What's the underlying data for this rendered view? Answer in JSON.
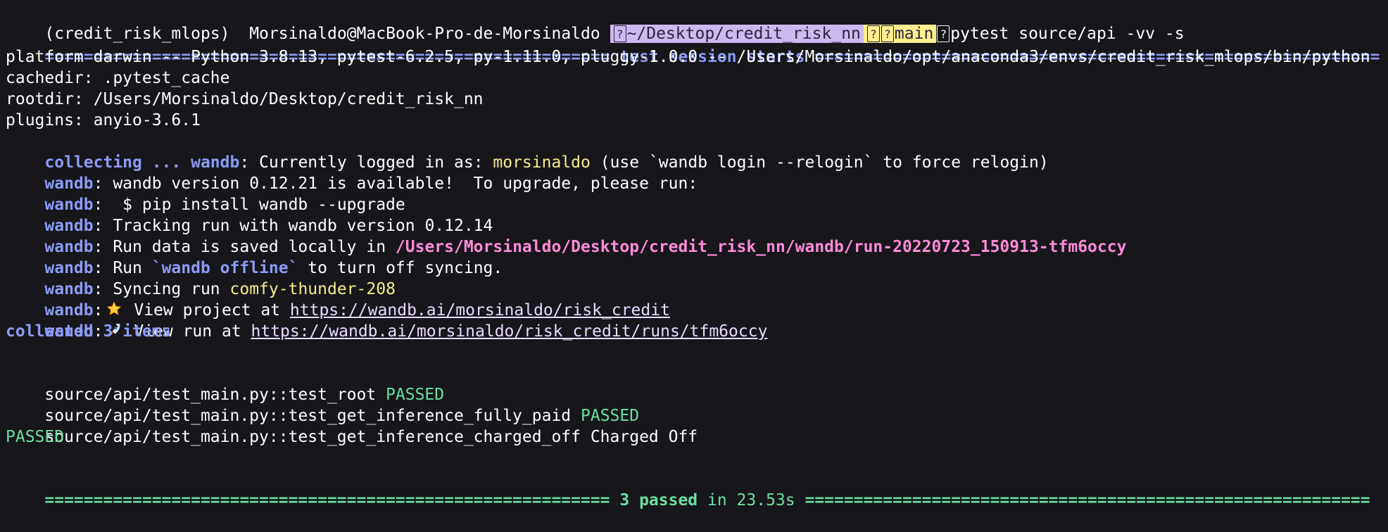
{
  "terminal": {
    "prompt": {
      "env": "(credit_risk_mlops)",
      "user_host": "Morsinaldo@MacBook-Pro-de-Morsinaldo",
      "icon_1": "?",
      "path": "~/Desktop/credit_risk_nn",
      "icon_2": "?",
      "icon_3": "?",
      "branch": "main",
      "icon_4": "?",
      "command": "pytest source/api -vv -s"
    },
    "session_header": {
      "left": "==========================================================",
      "title": " test session starts ",
      "right": "=========================================================="
    },
    "lines": [
      "platform darwin -- Python 3.8.13, pytest-6.2.5, py-1.11.0, pluggy-1.0.0 -- /Users/Morsinaldo/opt/anaconda3/envs/credit_risk_mlops/bin/python",
      "cachedir: .pytest_cache",
      "rootdir: /Users/Morsinaldo/Desktop/credit_risk_nn",
      "plugins: anyio-3.6.1"
    ],
    "collecting_prefix": "collecting ... ",
    "wandb_label": "wandb",
    "wandb": {
      "logged_in_prefix": ": Currently logged in as: ",
      "logged_in_user": "morsinaldo",
      "logged_in_suffix": " (use `wandb login --relogin` to force relogin)",
      "version_available": ": wandb version 0.12.21 is available!  To upgrade, please run:",
      "pip_install": ":  $ pip install wandb --upgrade",
      "tracking": ": Tracking run with wandb version 0.12.14",
      "run_data_prefix": ": Run data is saved locally in ",
      "run_data_path": "/Users/Morsinaldo/Desktop/credit_risk_nn/wandb/run-20220723_150913-tfm6occy",
      "run_offline_prefix": ": Run ",
      "run_offline_cmd": "`wandb offline`",
      "run_offline_suffix": " to turn off syncing.",
      "syncing_prefix": ": Syncing run ",
      "syncing_name": "comfy-thunder-208",
      "project_prefix": ":",
      "project_text": " View project at ",
      "project_url": "https://wandb.ai/morsinaldo/risk_credit",
      "run_prefix": ":",
      "run_text": " View run at ",
      "run_url": "https://wandb.ai/morsinaldo/risk_credit/runs/tfm6occy"
    },
    "collected": "collected 3 items",
    "tests": [
      {
        "name": "source/api/test_main.py::test_root ",
        "result": "PASSED"
      },
      {
        "name": "source/api/test_main.py::test_get_inference_fully_paid ",
        "result": "PASSED"
      },
      {
        "name": "source/api/test_main.py::test_get_inference_charged_off Charged Off",
        "result": ""
      }
    ],
    "final_passed": "PASSED",
    "summary": {
      "left": "==========================================================",
      "passed": " 3 passed",
      "time": " in 23.53s ",
      "right": "=========================================================="
    }
  }
}
